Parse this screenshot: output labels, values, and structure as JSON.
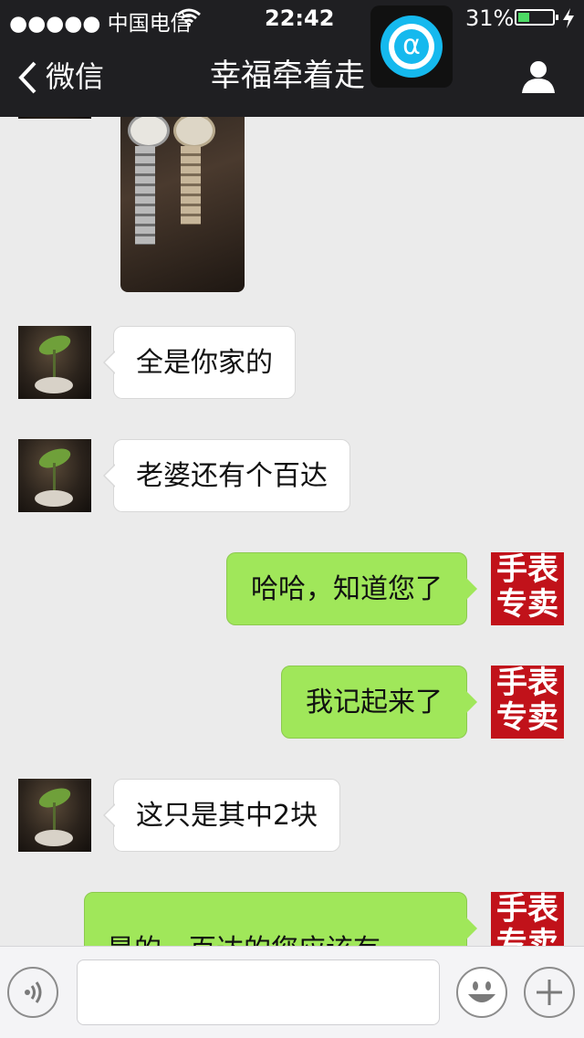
{
  "status": {
    "carrier": "●●●●● 中国电信",
    "time": "22:42",
    "battery": "31%"
  },
  "overlay": {
    "glyph": "α"
  },
  "nav": {
    "back": "微信",
    "title": "幸福牵着走"
  },
  "brand": {
    "line1": "手表",
    "line2": "专卖"
  },
  "messages": [
    {
      "side": "left",
      "text": "全是你家的"
    },
    {
      "side": "left",
      "text": "老婆还有个百达"
    },
    {
      "side": "right",
      "text": "哈哈，知道您了"
    },
    {
      "side": "right",
      "text": "我记起来了"
    },
    {
      "side": "left",
      "text": "这只是其中2块"
    },
    {
      "side": "right",
      "text": "是的，百达的您应该有一"
    }
  ],
  "colors": {
    "bar": "#1f1f22",
    "right_bubble": "#a0e75a",
    "brand": "#c1121a"
  },
  "icons": {
    "voice": "voice-icon",
    "emoji": "emoji-icon",
    "plus": "plus-icon",
    "profile": "person-icon"
  }
}
